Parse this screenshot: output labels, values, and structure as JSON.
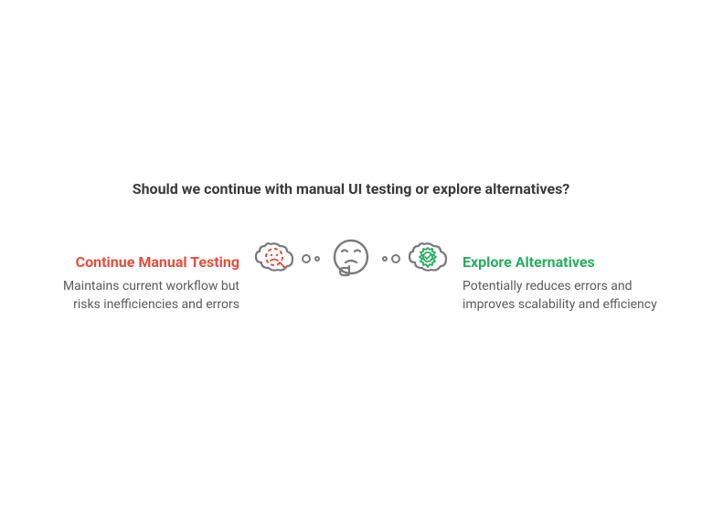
{
  "question": "Should we continue with manual UI testing or explore alternatives?",
  "left": {
    "title": "Continue Manual Testing",
    "desc": "Maintains current workflow but risks inefficiencies and errors"
  },
  "right": {
    "title": "Explore Alternatives",
    "desc": "Potentially reduces errors and improves scalability and efficiency"
  },
  "colors": {
    "left_accent": "#e74c3c",
    "right_accent": "#27ae60",
    "neutral": "#7a7a7a"
  },
  "icons": {
    "left_bubble": "sad-dashed-face",
    "center": "thinking-face",
    "right_bubble": "gear-check"
  }
}
